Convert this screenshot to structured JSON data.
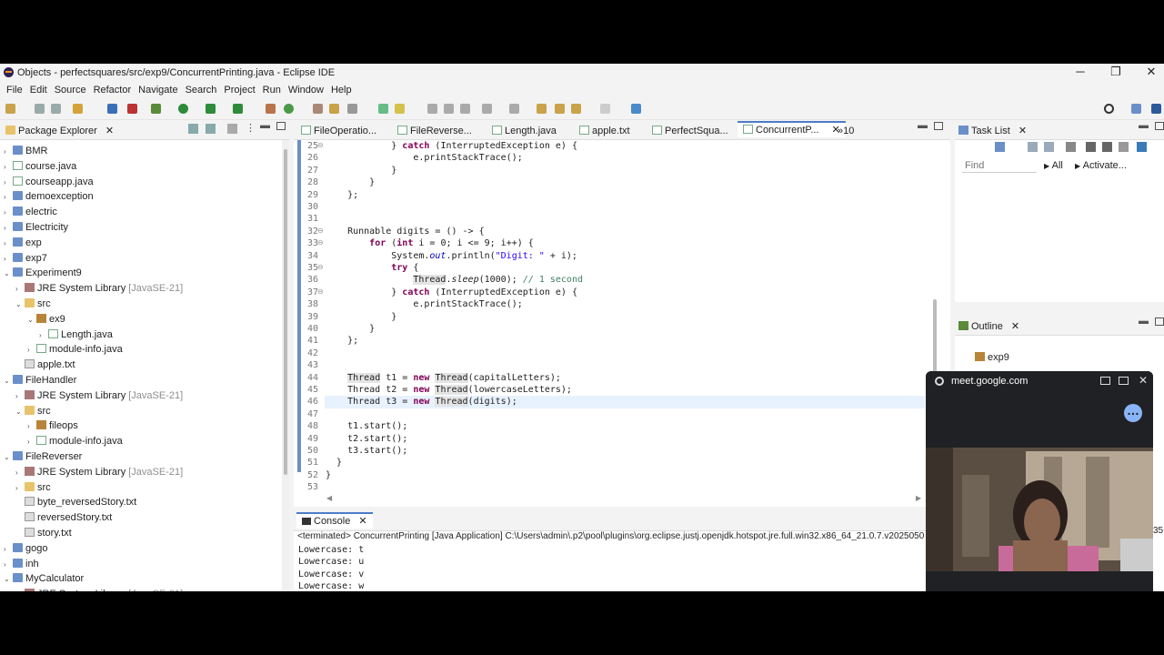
{
  "window": {
    "title": "Objects - perfectsquares/src/exp9/ConcurrentPrinting.java - Eclipse IDE",
    "controls": [
      "─",
      "❐",
      "✕"
    ]
  },
  "menu": [
    "File",
    "Edit",
    "Source",
    "Refactor",
    "Navigate",
    "Search",
    "Project",
    "Run",
    "Window",
    "Help"
  ],
  "package_explorer": {
    "title": "Package Explorer",
    "items": [
      {
        "label": "BMR",
        "type": "proj",
        "indent": 0,
        "arrow": "›"
      },
      {
        "label": "course.java",
        "type": "jfile",
        "indent": 0,
        "arrow": "›"
      },
      {
        "label": "courseapp.java",
        "type": "jfile",
        "indent": 0,
        "arrow": "›"
      },
      {
        "label": "demoexception",
        "type": "proj",
        "indent": 0,
        "arrow": "›"
      },
      {
        "label": "electric",
        "type": "proj",
        "indent": 0,
        "arrow": "›"
      },
      {
        "label": "Electricity",
        "type": "proj",
        "indent": 0,
        "arrow": "›"
      },
      {
        "label": "exp",
        "type": "proj",
        "indent": 0,
        "arrow": "›"
      },
      {
        "label": "exp7",
        "type": "proj",
        "indent": 0,
        "arrow": "›"
      },
      {
        "label": "Experiment9",
        "type": "proj",
        "indent": 0,
        "arrow": "⌄"
      },
      {
        "label": "JRE System Library",
        "suffix": "[JavaSE-21]",
        "type": "lib",
        "indent": 1,
        "arrow": "›"
      },
      {
        "label": "src",
        "type": "fold",
        "indent": 1,
        "arrow": "⌄"
      },
      {
        "label": "ex9",
        "type": "pkg",
        "indent": 2,
        "arrow": "⌄"
      },
      {
        "label": "Length.java",
        "type": "jfile",
        "indent": 3,
        "arrow": "›"
      },
      {
        "label": "module-info.java",
        "type": "jfile",
        "indent": 2,
        "arrow": "›"
      },
      {
        "label": "apple.txt",
        "type": "file",
        "indent": 1,
        "arrow": ""
      },
      {
        "label": "FileHandler",
        "type": "proj",
        "indent": 0,
        "arrow": "⌄"
      },
      {
        "label": "JRE System Library",
        "suffix": "[JavaSE-21]",
        "type": "lib",
        "indent": 1,
        "arrow": "›"
      },
      {
        "label": "src",
        "type": "fold",
        "indent": 1,
        "arrow": "⌄"
      },
      {
        "label": "fileops",
        "type": "pkg",
        "indent": 2,
        "arrow": "›"
      },
      {
        "label": "module-info.java",
        "type": "jfile",
        "indent": 2,
        "arrow": "›"
      },
      {
        "label": "FileReverser",
        "type": "proj",
        "indent": 0,
        "arrow": "⌄"
      },
      {
        "label": "JRE System Library",
        "suffix": "[JavaSE-21]",
        "type": "lib",
        "indent": 1,
        "arrow": "›"
      },
      {
        "label": "src",
        "type": "fold",
        "indent": 1,
        "arrow": "›"
      },
      {
        "label": "byte_reversedStory.txt",
        "type": "file",
        "indent": 1,
        "arrow": ""
      },
      {
        "label": "reversedStory.txt",
        "type": "file",
        "indent": 1,
        "arrow": ""
      },
      {
        "label": "story.txt",
        "type": "file",
        "indent": 1,
        "arrow": ""
      },
      {
        "label": "gogo",
        "type": "proj",
        "indent": 0,
        "arrow": "›"
      },
      {
        "label": "inh",
        "type": "proj",
        "indent": 0,
        "arrow": "›"
      },
      {
        "label": "MyCalculator",
        "type": "proj",
        "indent": 0,
        "arrow": "⌄"
      },
      {
        "label": "JRE System Library",
        "suffix": "[JavaSE-21]",
        "type": "lib",
        "indent": 1,
        "arrow": "›"
      }
    ]
  },
  "editor_tabs": [
    {
      "label": "FileOperatio...",
      "active": false
    },
    {
      "label": "FileReverse...",
      "active": false
    },
    {
      "label": "Length.java",
      "active": false
    },
    {
      "label": "apple.txt",
      "active": false
    },
    {
      "label": "PerfectSqua...",
      "active": false
    },
    {
      "label": "ConcurrentP...",
      "active": true
    }
  ],
  "editor_overflow": "»10",
  "code_lines": [
    {
      "n": "25",
      "html": "            } <span class=\"kw\">catch</span> (InterruptedException e) {",
      "fold": "⊖"
    },
    {
      "n": "26",
      "html": "                e.printStackTrace();"
    },
    {
      "n": "27",
      "html": "            }"
    },
    {
      "n": "28",
      "html": "        }"
    },
    {
      "n": "29",
      "html": "    };"
    },
    {
      "n": "30",
      "html": ""
    },
    {
      "n": "31",
      "html": ""
    },
    {
      "n": "32",
      "html": "    Runnable digits = () -> {",
      "fold": "⊖"
    },
    {
      "n": "33",
      "html": "        <span class=\"kw\">for</span> (<span class=\"kw\">int</span> i = 0; i <= 9; i++) {",
      "fold": "⊖"
    },
    {
      "n": "34",
      "html": "            System.<span class=\"fld\">out</span>.println(<span class=\"st\">\"Digit: \"</span> + i);"
    },
    {
      "n": "35",
      "html": "            <span class=\"kw\">try</span> {",
      "fold": "⊖"
    },
    {
      "n": "36",
      "html": "                <span class=\"hl\">Thread</span>.<span class=\"mtd\">sleep</span>(1000); <span class=\"cm\">// 1 second</span>"
    },
    {
      "n": "37",
      "html": "            } <span class=\"kw\">catch</span> (InterruptedException e) {",
      "fold": "⊖"
    },
    {
      "n": "38",
      "html": "                e.printStackTrace();"
    },
    {
      "n": "39",
      "html": "            }"
    },
    {
      "n": "40",
      "html": "        }"
    },
    {
      "n": "41",
      "html": "    };"
    },
    {
      "n": "42",
      "html": ""
    },
    {
      "n": "43",
      "html": ""
    },
    {
      "n": "44",
      "html": "    <span class=\"hl\">Thread</span> t1 = <span class=\"kw\">new</span> <span class=\"hl\">Thread</span>(capitalLetters);"
    },
    {
      "n": "45",
      "html": "    Thread t2 = <span class=\"kw\">new</span> <span class=\"hl\">Thread</span>(lowercaseLetters);"
    },
    {
      "n": "46",
      "html": "    Thread t3 = <span class=\"kw\">new</span> <span class=\"hl\">Thread</span>(digits);",
      "current": true
    },
    {
      "n": "47",
      "html": ""
    },
    {
      "n": "48",
      "html": "    t1.start();"
    },
    {
      "n": "49",
      "html": "    t2.start();"
    },
    {
      "n": "50",
      "html": "    t3.start();"
    },
    {
      "n": "51",
      "html": "  }"
    },
    {
      "n": "52",
      "html": "}"
    },
    {
      "n": "53",
      "html": ""
    }
  ],
  "console": {
    "title": "Console",
    "terminated": "<terminated> ConcurrentPrinting [Java Application] C:\\Users\\admin\\.p2\\pool\\plugins\\org.eclipse.justj.openjdk.hotspot.jre.full.win32.x86_64_21.0.7.v2025050",
    "lines": [
      "Lowercase: t",
      "Lowercase: u",
      "Lowercase: v",
      "Lowercase: w"
    ],
    "overflow_right": "35"
  },
  "task_list": {
    "title": "Task List",
    "find_placeholder": "Find",
    "all_label": "All",
    "activate_label": "Activate..."
  },
  "outline": {
    "title": "Outline",
    "item": "exp9"
  },
  "meet": {
    "url": "meet.google.com"
  },
  "colors": {
    "accent": "#4b7cc8",
    "keyword": "#7f0055",
    "string": "#2a00ff",
    "comment": "#3f7f5f"
  }
}
